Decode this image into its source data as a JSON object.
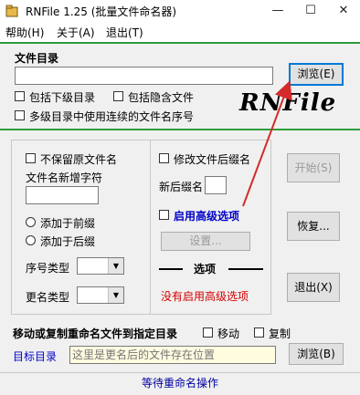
{
  "window": {
    "title": "RNFile 1.25  (批量文件命名器)",
    "minimize_glyph": "—",
    "maximize_glyph": "☐",
    "close_glyph": "✕"
  },
  "menu": {
    "items": [
      "帮助(H)",
      "关于(A)",
      "退出(T)"
    ]
  },
  "dir": {
    "label": "文件目录",
    "value": "",
    "browse_label": "浏览(E)",
    "include_subdirs": {
      "label": "包括下级目录",
      "checked": false
    },
    "include_hidden": {
      "label": "包括隐含文件",
      "checked": false
    },
    "continuous_seq": {
      "label": "多级目录中使用连续的文件名序号",
      "checked": false
    }
  },
  "logo_text": "RNFile",
  "left_panel": {
    "keep_name": {
      "label": "不保留原文件名",
      "checked": false
    },
    "new_chars_label": "文件名新增字符",
    "new_chars_value": "",
    "prefix": {
      "label": "添加于前缀",
      "selected": false
    },
    "suffix": {
      "label": "添加于后缀",
      "selected": false
    },
    "seq_type_label": "序号类型",
    "seq_type_value": "",
    "rename_type_label": "更名类型",
    "rename_type_value": ""
  },
  "right_panel": {
    "modify_ext": {
      "label": "修改文件后缀名",
      "checked": false
    },
    "new_ext_label": "新后缀名",
    "new_ext_value": "",
    "advanced": {
      "label": "启用高级选项",
      "checked": false
    },
    "settings_label": "设置...",
    "options_title": "选项",
    "options_status": "没有启用高级选项"
  },
  "actions": {
    "start_label": "开始(S)",
    "restore_label": "恢复...",
    "exit_label": "退出(X)"
  },
  "move": {
    "title": "移动或复制重命名文件到指定目录",
    "move_option": {
      "label": "移动",
      "checked": false
    },
    "copy_option": {
      "label": "复制",
      "checked": false
    },
    "target_label": "目标目录",
    "target_placeholder": "这里是更名后的文件存在位置",
    "browse_label": "浏览(B)"
  },
  "status": {
    "text": "等待重命名操作"
  },
  "colors": {
    "accent_green": "#2e9c3d",
    "advanced_label_blue": "#0000c8",
    "status_red": "#d40000",
    "target_label_blue": "#0000c8",
    "target_input_bg": "#fffce0",
    "arrow_red": "#d42a2a",
    "options_title_red": "#cc0000"
  }
}
